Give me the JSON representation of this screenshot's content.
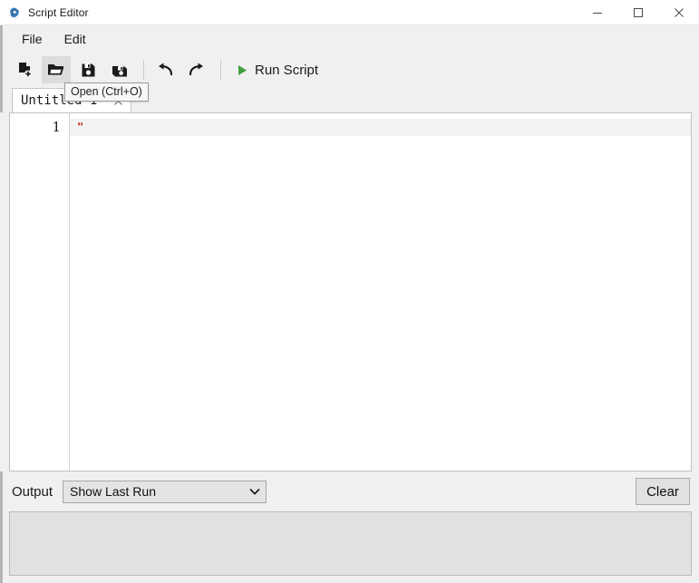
{
  "window": {
    "title": "Script Editor",
    "app_icon": "app-logo-icon",
    "controls": {
      "minimize": "minimize-icon",
      "maximize": "maximize-icon",
      "close": "close-icon"
    }
  },
  "menu": {
    "items": [
      {
        "label": "File",
        "name": "menu-file"
      },
      {
        "label": "Edit",
        "name": "menu-edit"
      }
    ]
  },
  "toolbar": {
    "buttons": [
      {
        "name": "new-file-button",
        "icon": "new-file-icon",
        "hover": false
      },
      {
        "name": "open-file-button",
        "icon": "open-folder-icon",
        "hover": true
      },
      {
        "name": "save-button",
        "icon": "save-floppy-icon",
        "hover": false
      },
      {
        "name": "save-as-button",
        "icon": "save-as-floppy-icon",
        "hover": false
      },
      {
        "name": "undo-button",
        "icon": "undo-arrow-icon",
        "hover": false
      },
      {
        "name": "redo-button",
        "icon": "redo-arrow-icon",
        "hover": false
      }
    ],
    "run_label": "Run Script",
    "run_icon": "play-triangle-icon",
    "run_icon_color": "#3f9e3f"
  },
  "tooltip": {
    "text": "Open (Ctrl+O)",
    "visible": true
  },
  "tabs": [
    {
      "label": "Untitled-1*",
      "close_icon": "close-tab-icon",
      "active": true
    }
  ],
  "editor": {
    "line_numbers": [
      "1"
    ],
    "lines": [
      {
        "text": "\"",
        "token": "string"
      }
    ],
    "string_color": "#c02020",
    "current_line_highlight": "#f2f2f2"
  },
  "output": {
    "label": "Output",
    "select_value": "Show Last Run",
    "select_options": [
      "Show Last Run"
    ],
    "select_arrow_icon": "chevron-down-icon",
    "clear_label": "Clear",
    "text": ""
  }
}
